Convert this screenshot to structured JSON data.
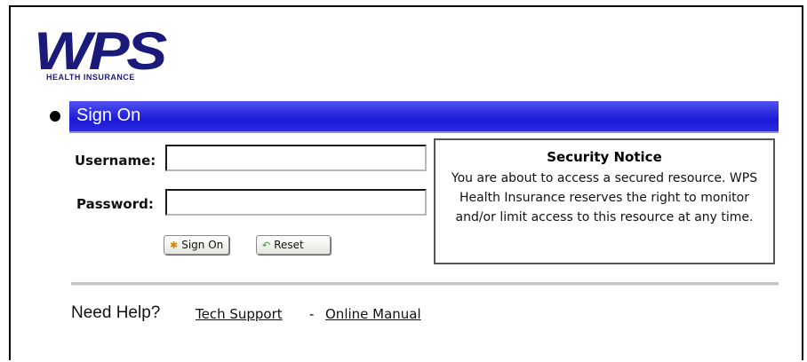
{
  "brand": {
    "logo_text": "WPS",
    "logo_subtext": "HEALTH INSURANCE",
    "logo_color": "#1a1a7a"
  },
  "signon": {
    "title": "Sign On",
    "bar_color": "#2424dc"
  },
  "form": {
    "username_label": "Username:",
    "username_value": "",
    "password_label": "Password:",
    "password_value": "",
    "signon_button": "Sign On",
    "reset_button": "Reset"
  },
  "notice": {
    "title": "Security Notice",
    "body": "You are about to access a secured resource. WPS Health Insurance reserves the right to monitor and/or limit access to this resource at any time."
  },
  "help": {
    "label": "Need Help?",
    "separator": "-",
    "tech_support": "Tech Support",
    "online_manual": "Online Manual"
  }
}
